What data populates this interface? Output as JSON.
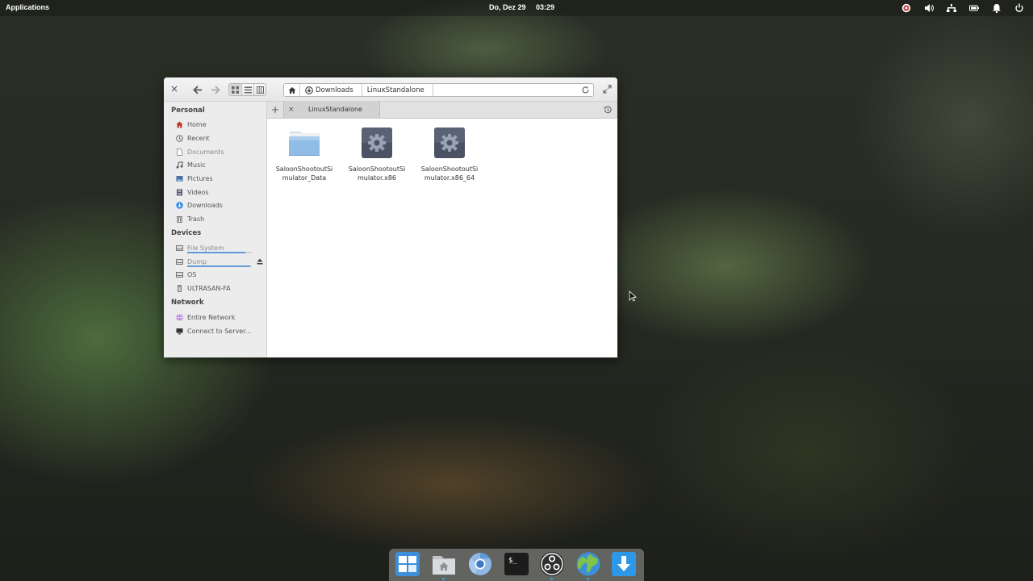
{
  "panel": {
    "applications_label": "Applications",
    "date": "Do, Dez 29",
    "time": "03:29"
  },
  "window": {
    "close_icon": "close-icon",
    "back_icon": "arrow-left-icon",
    "forward_icon": "arrow-right-icon",
    "view_modes": [
      "icon-grid-view",
      "list-view",
      "column-view"
    ],
    "active_view": "icon-grid-view",
    "path": {
      "home_icon": "home-icon",
      "crumbs": [
        {
          "label": "Downloads",
          "icon": "download-icon"
        },
        {
          "label": "LinuxStandalone"
        }
      ],
      "reload_icon": "reload-icon"
    },
    "maximize_icon": "maximize-icon"
  },
  "sidebar": {
    "sections": [
      {
        "title": "Personal",
        "items": [
          {
            "label": "Home",
            "icon": "home-icon"
          },
          {
            "label": "Recent",
            "icon": "clock-icon"
          },
          {
            "label": "Documents",
            "icon": "document-icon"
          },
          {
            "label": "Music",
            "icon": "music-icon"
          },
          {
            "label": "Pictures",
            "icon": "picture-icon"
          },
          {
            "label": "Videos",
            "icon": "film-icon"
          },
          {
            "label": "Downloads",
            "icon": "download-icon"
          },
          {
            "label": "Trash",
            "icon": "trash-icon"
          }
        ]
      },
      {
        "title": "Devices",
        "items": [
          {
            "label": "File System",
            "icon": "drive-icon",
            "usage": 0.9
          },
          {
            "label": "Dump",
            "icon": "drive-icon",
            "usage": 0.98,
            "ejectable": true
          },
          {
            "label": "OS",
            "icon": "drive-icon"
          },
          {
            "label": "ULTRASAN-FA",
            "icon": "usb-drive-icon"
          }
        ]
      },
      {
        "title": "Network",
        "items": [
          {
            "label": "Entire Network",
            "icon": "network-icon"
          },
          {
            "label": "Connect to Server...",
            "icon": "monitor-icon"
          }
        ]
      }
    ]
  },
  "tabs": [
    {
      "label": "LinuxStandalone"
    }
  ],
  "files": [
    {
      "name": "SaloonShootoutSimulator_Data",
      "type": "folder"
    },
    {
      "name": "SaloonShootoutSimulator.x86",
      "type": "executable"
    },
    {
      "name": "SaloonShootoutSimulator.x86_64",
      "type": "executable"
    }
  ],
  "dock": {
    "apps": [
      "multitasking-view-icon",
      "files-icon",
      "chromium-icon",
      "terminal-icon",
      "obs-icon",
      "browser-icon",
      "downloader-icon"
    ]
  },
  "colors": {
    "accent": "#3689e6",
    "panel_text": "#ffffff",
    "sidebar_bg": "#ececec"
  }
}
